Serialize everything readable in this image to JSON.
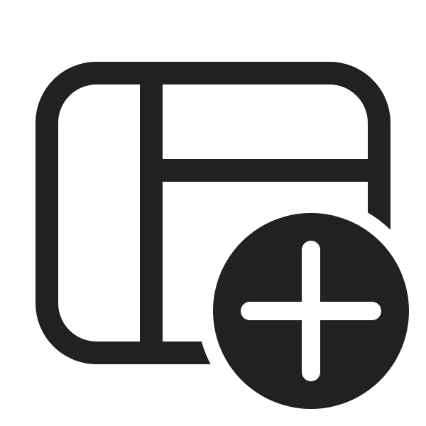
{
  "icon": {
    "name": "table-add-icon",
    "parts": [
      "layout-frame",
      "left-column",
      "header-row",
      "add-badge",
      "plus-sign"
    ],
    "color": "#212121",
    "background": "#ffffff"
  }
}
